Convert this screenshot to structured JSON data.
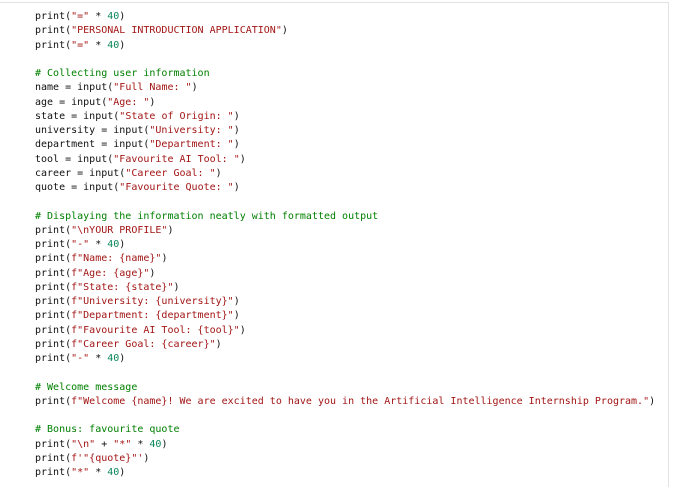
{
  "code_lines": [
    "print(\"=\" * 40)",
    "print(\"PERSONAL INTRODUCTION APPLICATION\")",
    "print(\"=\" * 40)",
    "",
    "# Collecting user information",
    "name = input(\"Full Name: \")",
    "age = input(\"Age: \")",
    "state = input(\"State of Origin: \")",
    "university = input(\"University: \")",
    "department = input(\"Department: \")",
    "tool = input(\"Favourite AI Tool: \")",
    "career = input(\"Career Goal: \")",
    "quote = input(\"Favourite Quote: \")",
    "",
    "# Displaying the information neatly with formatted output",
    "print(\"\\nYOUR PROFILE\")",
    "print(\"-\" * 40)",
    "print(f\"Name: {name}\")",
    "print(f\"Age: {age}\")",
    "print(f\"State: {state}\")",
    "print(f\"University: {university}\")",
    "print(f\"Department: {department}\")",
    "print(f\"Favourite AI Tool: {tool}\")",
    "print(f\"Career Goal: {career}\")",
    "print(\"-\" * 40)",
    "",
    "# Welcome message",
    "print(f\"Welcome {name}! We are excited to have you in the Artificial Intelligence Internship Program.\")",
    "",
    "# Bonus: favourite quote",
    "print(\"\\n\" + \"*\" * 40)",
    "print(f'\"{quote}\"')",
    "print(\"*\" * 40)"
  ],
  "colors": {
    "background": "#ffffff",
    "text": "#111111",
    "string": "#a31515",
    "comment": "#008000",
    "number": "#098658",
    "border": "#e3e3e3"
  }
}
